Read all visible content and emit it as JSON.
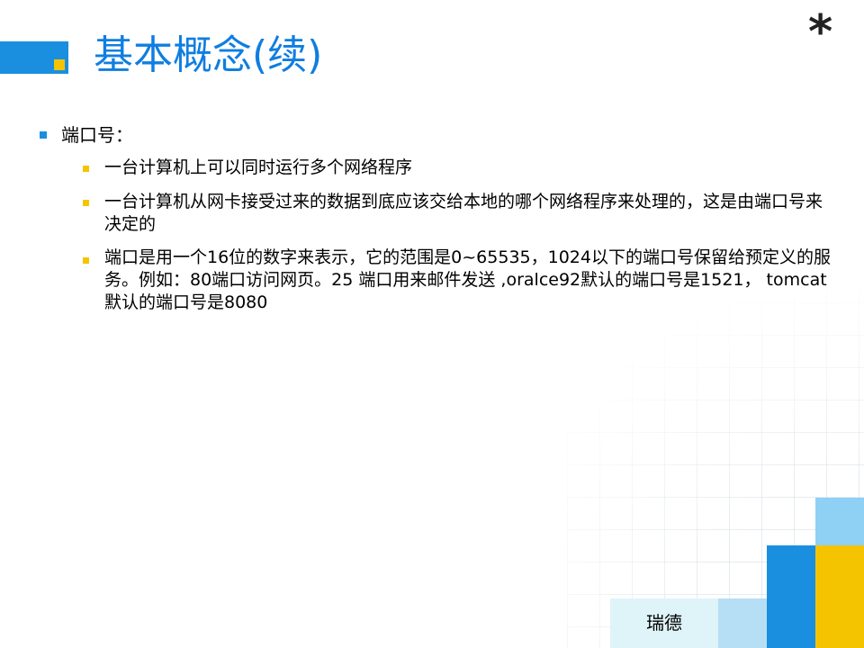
{
  "slide": {
    "title": "基本概念(续)",
    "corner_mark": "*",
    "level1_item": "端口号：",
    "sub_items": [
      "一台计算机上可以同时运行多个网络程序",
      "一台计算机从网卡接受过来的数据到底应该交给本地的哪个网络程序来处理的，这是由端口号来决定的",
      "端口是用一个16位的数字来表示，它的范围是0~65535，1024以下的端口号保留给预定义的服务。例如：80端口访问网页。25 端口用来邮件发送 ,oralce92默认的端口号是1521， tomcat默认的端口号是8080"
    ],
    "footer_label": "瑞德"
  },
  "colors": {
    "accent_blue": "#1a8fe0",
    "accent_yellow": "#f5c400",
    "title_blue": "#0f7ee0",
    "light_blue": "#8fd0f5"
  }
}
